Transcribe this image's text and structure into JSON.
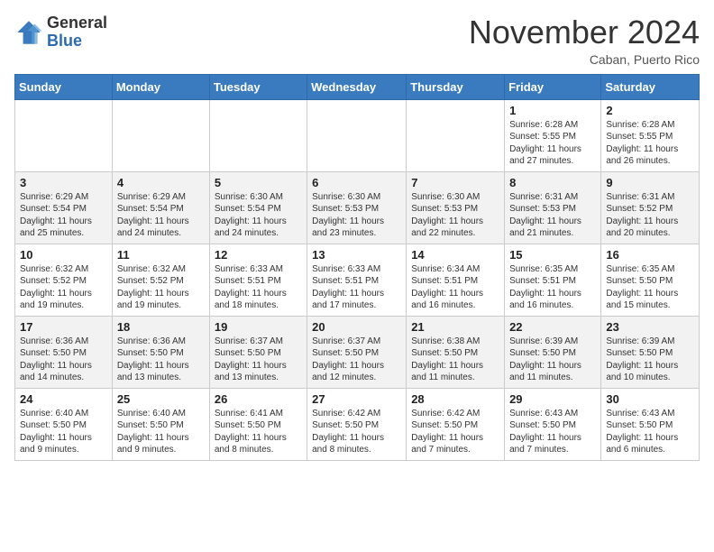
{
  "header": {
    "logo_general": "General",
    "logo_blue": "Blue",
    "month": "November 2024",
    "location": "Caban, Puerto Rico"
  },
  "days_of_week": [
    "Sunday",
    "Monday",
    "Tuesday",
    "Wednesday",
    "Thursday",
    "Friday",
    "Saturday"
  ],
  "weeks": [
    [
      {
        "day": "",
        "info": ""
      },
      {
        "day": "",
        "info": ""
      },
      {
        "day": "",
        "info": ""
      },
      {
        "day": "",
        "info": ""
      },
      {
        "day": "",
        "info": ""
      },
      {
        "day": "1",
        "info": "Sunrise: 6:28 AM\nSunset: 5:55 PM\nDaylight: 11 hours\nand 27 minutes."
      },
      {
        "day": "2",
        "info": "Sunrise: 6:28 AM\nSunset: 5:55 PM\nDaylight: 11 hours\nand 26 minutes."
      }
    ],
    [
      {
        "day": "3",
        "info": "Sunrise: 6:29 AM\nSunset: 5:54 PM\nDaylight: 11 hours\nand 25 minutes."
      },
      {
        "day": "4",
        "info": "Sunrise: 6:29 AM\nSunset: 5:54 PM\nDaylight: 11 hours\nand 24 minutes."
      },
      {
        "day": "5",
        "info": "Sunrise: 6:30 AM\nSunset: 5:54 PM\nDaylight: 11 hours\nand 24 minutes."
      },
      {
        "day": "6",
        "info": "Sunrise: 6:30 AM\nSunset: 5:53 PM\nDaylight: 11 hours\nand 23 minutes."
      },
      {
        "day": "7",
        "info": "Sunrise: 6:30 AM\nSunset: 5:53 PM\nDaylight: 11 hours\nand 22 minutes."
      },
      {
        "day": "8",
        "info": "Sunrise: 6:31 AM\nSunset: 5:53 PM\nDaylight: 11 hours\nand 21 minutes."
      },
      {
        "day": "9",
        "info": "Sunrise: 6:31 AM\nSunset: 5:52 PM\nDaylight: 11 hours\nand 20 minutes."
      }
    ],
    [
      {
        "day": "10",
        "info": "Sunrise: 6:32 AM\nSunset: 5:52 PM\nDaylight: 11 hours\nand 19 minutes."
      },
      {
        "day": "11",
        "info": "Sunrise: 6:32 AM\nSunset: 5:52 PM\nDaylight: 11 hours\nand 19 minutes."
      },
      {
        "day": "12",
        "info": "Sunrise: 6:33 AM\nSunset: 5:51 PM\nDaylight: 11 hours\nand 18 minutes."
      },
      {
        "day": "13",
        "info": "Sunrise: 6:33 AM\nSunset: 5:51 PM\nDaylight: 11 hours\nand 17 minutes."
      },
      {
        "day": "14",
        "info": "Sunrise: 6:34 AM\nSunset: 5:51 PM\nDaylight: 11 hours\nand 16 minutes."
      },
      {
        "day": "15",
        "info": "Sunrise: 6:35 AM\nSunset: 5:51 PM\nDaylight: 11 hours\nand 16 minutes."
      },
      {
        "day": "16",
        "info": "Sunrise: 6:35 AM\nSunset: 5:50 PM\nDaylight: 11 hours\nand 15 minutes."
      }
    ],
    [
      {
        "day": "17",
        "info": "Sunrise: 6:36 AM\nSunset: 5:50 PM\nDaylight: 11 hours\nand 14 minutes."
      },
      {
        "day": "18",
        "info": "Sunrise: 6:36 AM\nSunset: 5:50 PM\nDaylight: 11 hours\nand 13 minutes."
      },
      {
        "day": "19",
        "info": "Sunrise: 6:37 AM\nSunset: 5:50 PM\nDaylight: 11 hours\nand 13 minutes."
      },
      {
        "day": "20",
        "info": "Sunrise: 6:37 AM\nSunset: 5:50 PM\nDaylight: 11 hours\nand 12 minutes."
      },
      {
        "day": "21",
        "info": "Sunrise: 6:38 AM\nSunset: 5:50 PM\nDaylight: 11 hours\nand 11 minutes."
      },
      {
        "day": "22",
        "info": "Sunrise: 6:39 AM\nSunset: 5:50 PM\nDaylight: 11 hours\nand 11 minutes."
      },
      {
        "day": "23",
        "info": "Sunrise: 6:39 AM\nSunset: 5:50 PM\nDaylight: 11 hours\nand 10 minutes."
      }
    ],
    [
      {
        "day": "24",
        "info": "Sunrise: 6:40 AM\nSunset: 5:50 PM\nDaylight: 11 hours\nand 9 minutes."
      },
      {
        "day": "25",
        "info": "Sunrise: 6:40 AM\nSunset: 5:50 PM\nDaylight: 11 hours\nand 9 minutes."
      },
      {
        "day": "26",
        "info": "Sunrise: 6:41 AM\nSunset: 5:50 PM\nDaylight: 11 hours\nand 8 minutes."
      },
      {
        "day": "27",
        "info": "Sunrise: 6:42 AM\nSunset: 5:50 PM\nDaylight: 11 hours\nand 8 minutes."
      },
      {
        "day": "28",
        "info": "Sunrise: 6:42 AM\nSunset: 5:50 PM\nDaylight: 11 hours\nand 7 minutes."
      },
      {
        "day": "29",
        "info": "Sunrise: 6:43 AM\nSunset: 5:50 PM\nDaylight: 11 hours\nand 7 minutes."
      },
      {
        "day": "30",
        "info": "Sunrise: 6:43 AM\nSunset: 5:50 PM\nDaylight: 11 hours\nand 6 minutes."
      }
    ]
  ]
}
